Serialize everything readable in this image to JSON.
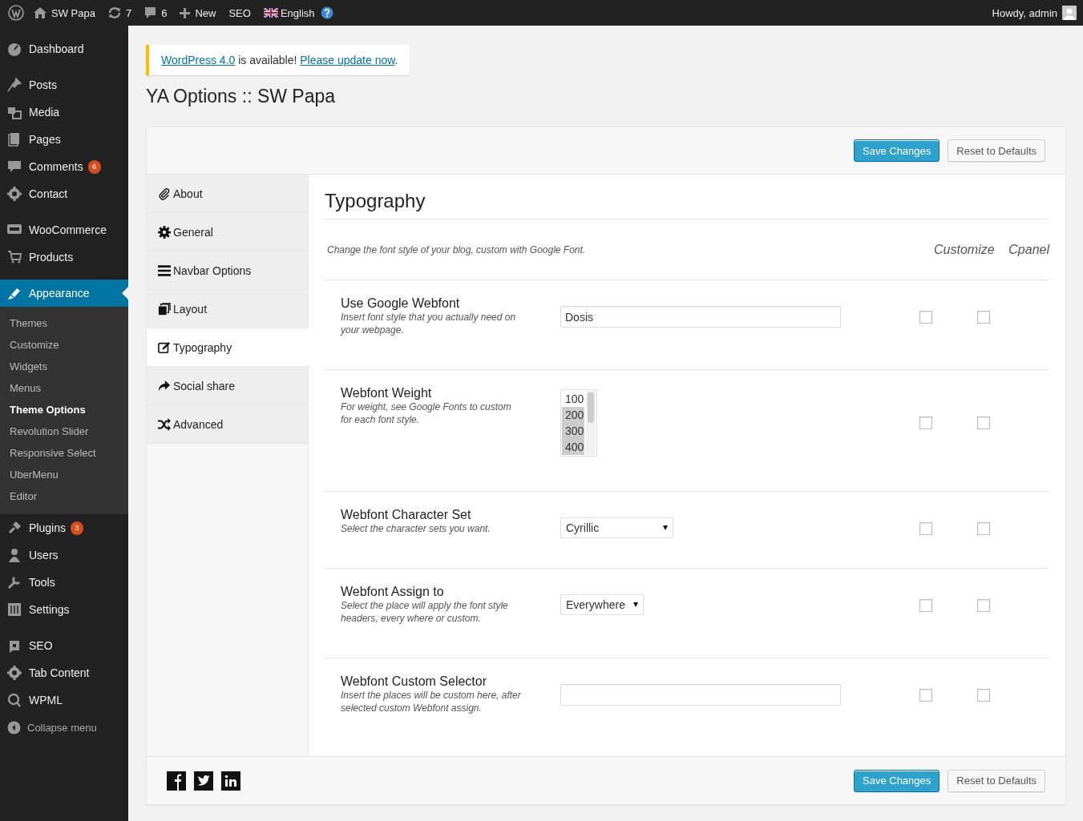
{
  "admin_bar": {
    "site": "SW Papa",
    "updates": "7",
    "comments": "6",
    "new": "New",
    "seo": "SEO",
    "language": "English",
    "greeting": "Howdy, admin"
  },
  "sidebar": {
    "groups": [
      [
        {
          "label": "Dashboard",
          "selected": false
        }
      ],
      [
        {
          "label": "Posts",
          "selected": false
        },
        {
          "label": "Media",
          "selected": false
        },
        {
          "label": "Pages",
          "selected": false
        },
        {
          "label": "Comments",
          "badge": "6",
          "selected": false
        },
        {
          "label": "Contact",
          "selected": false
        }
      ],
      [
        {
          "label": "WooCommerce",
          "selected": false
        },
        {
          "label": "Products",
          "selected": false
        }
      ],
      [
        {
          "label": "Appearance",
          "selected": true,
          "children": [
            {
              "label": "Themes",
              "selected": false
            },
            {
              "label": "Customize",
              "selected": false
            },
            {
              "label": "Widgets",
              "selected": false
            },
            {
              "label": "Menus",
              "selected": false
            },
            {
              "label": "Theme Options",
              "selected": true
            },
            {
              "label": "Revolution Slider",
              "selected": false
            },
            {
              "label": "Responsive Select",
              "selected": false
            },
            {
              "label": "UberMenu",
              "selected": false
            },
            {
              "label": "Editor",
              "selected": false
            }
          ]
        },
        {
          "label": "Plugins",
          "badge": "3",
          "selected": false
        },
        {
          "label": "Users",
          "selected": false
        },
        {
          "label": "Tools",
          "selected": false
        },
        {
          "label": "Settings",
          "selected": false
        }
      ],
      [
        {
          "label": "SEO",
          "selected": false
        },
        {
          "label": "Tab Content",
          "selected": false
        },
        {
          "label": "WPML",
          "selected": false
        }
      ]
    ],
    "collapse": "Collapse menu"
  },
  "notice": {
    "link": "WordPress 4.0",
    "text": " is available! ",
    "action": "Please update now",
    "end": "."
  },
  "page_title": "YA Options :: SW Papa",
  "buttons": {
    "save": "Save Changes",
    "reset": "Reset to Defaults"
  },
  "tabs": [
    {
      "label": "About",
      "selected": false
    },
    {
      "label": "General",
      "selected": false
    },
    {
      "label": "Navbar Options",
      "selected": false
    },
    {
      "label": "Layout",
      "selected": false
    },
    {
      "label": "Typography",
      "selected": true
    },
    {
      "label": "Social share",
      "selected": false
    },
    {
      "label": "Advanced",
      "selected": false
    }
  ],
  "section": {
    "title": "Typography",
    "description": "Change the font style of your blog, custom with Google Font.",
    "columns": [
      "Customize",
      "Cpanel"
    ]
  },
  "fields": [
    {
      "kind": "text",
      "label": "Use Google Webfont",
      "help": "Insert font style that you actually need on your webpage.",
      "value": "Dosis",
      "customize": false,
      "cpanel": false
    },
    {
      "kind": "multiselect",
      "label": "Webfont Weight",
      "help": "For weight, see Google Fonts to custom for each font style.",
      "options": [
        {
          "label": "100",
          "selected": false
        },
        {
          "label": "200",
          "selected": true
        },
        {
          "label": "300",
          "selected": true
        },
        {
          "label": "400",
          "selected": true
        }
      ],
      "customize": false,
      "cpanel": false
    },
    {
      "kind": "select",
      "label": "Webfont Character Set",
      "help": "Select the character sets you want.",
      "value": "Cyrillic",
      "customize": false,
      "cpanel": false
    },
    {
      "kind": "select",
      "label": "Webfont Assign to",
      "help": "Select the place will apply the font style headers, every where or custom.",
      "value": "Everywhere",
      "customize": false,
      "cpanel": false
    },
    {
      "kind": "text",
      "label": "Webfont Custom Selector",
      "help": "Insert the places will be custom here, after selected custom Webfont assign.",
      "customize": false,
      "cpanel": false
    }
  ],
  "footer_buttons": {
    "save": "Save Changes",
    "reset": "Reset to Defaults"
  }
}
